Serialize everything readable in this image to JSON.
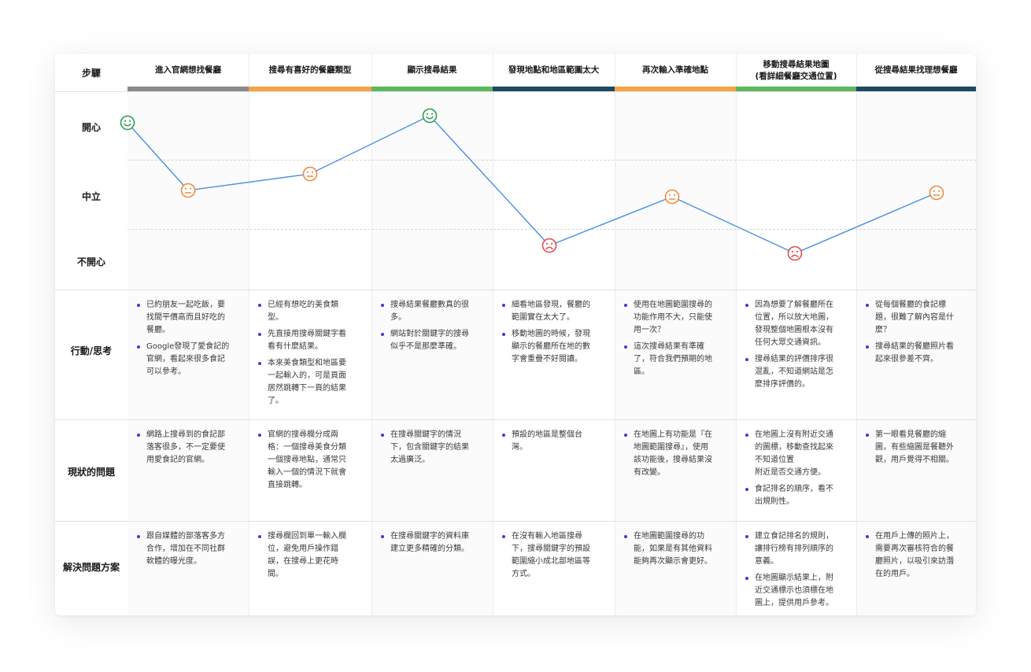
{
  "row_labels": {
    "step": "步驟",
    "happy": "開心",
    "neutral": "中立",
    "unhappy": "不開心",
    "action": "行動/思考",
    "problem": "現狀的問題",
    "solution": "解決問題方案"
  },
  "steps": [
    {
      "title": "進入官網想找餐廳",
      "color": "#8a8a8a",
      "emotion": "happy",
      "actions": [
        "已約朋友一起吃飯，要\n找間平價高而且好吃的\n餐廳。",
        "Google發現了愛食記的\n官網，看起來很多食記\n可以參考。"
      ],
      "problems": [
        "網路上搜尋到的食記部\n落客很多，不一定要使\n用愛食記的官網。"
      ],
      "solutions": [
        "跟自媒體的部落客多方\n合作，增加在不同社群\n軟體的曝光度。"
      ]
    },
    {
      "title": "搜尋有喜好的餐廳類型",
      "color": "#f5a445",
      "emotion": "neutral",
      "actions": [
        "已經有想吃的美食類\n型。",
        "先直接用搜尋關鍵字看\n看有什麼結果。",
        "本來美食類型和地區要\n一起輸入的，可是頁面\n居然跳轉下一頁的結果\n了。"
      ],
      "problems": [
        "官網的搜尋欄分成兩\n格：一個搜尋美食分類\n一個搜尋地點，通常只\n輸入一個的情況下就會\n直接跳轉。"
      ],
      "solutions": [
        "搜尋欄回到單一輸入欄\n位，避免用戶操作錯\n誤，在搜尋上更花時\n間。"
      ]
    },
    {
      "title": "顯示搜尋結果",
      "color": "#5cb85c",
      "emotion": "happy",
      "actions": [
        "搜尋結果餐廳數真的很\n多。",
        "網站對於關鍵字的搜尋\n似乎不是那麼準確。"
      ],
      "problems": [
        "在搜尋關鍵字的情況\n下，包含關鍵字的結果\n太過廣泛。"
      ],
      "solutions": [
        "在搜尋關鍵字的資料庫\n建立更多精確的分類。"
      ]
    },
    {
      "title": "發現地點和地區範圍太大",
      "color": "#1e4a5f",
      "emotion": "unhappy",
      "actions": [
        "細看地區發現，餐廳的\n範圍實在太大了。",
        "移動地圖的時候，發現\n顯示的餐廳所在地的數\n字會重疊不好閱讀。"
      ],
      "problems": [
        "預設的地區是整個台\n灣。"
      ],
      "solutions": [
        "在沒有輸入地區搜尋\n下，搜尋關鍵字的預設\n範圍縮小成北部地區等\n方式。"
      ]
    },
    {
      "title": "再次輸入準確地點",
      "color": "#f5a445",
      "emotion": "neutral",
      "actions": [
        "使用在地圖範圍搜尋的\n功能作用不大，只能使\n用一次？",
        "這次搜尋結果有準確\n了，符合我們預期的地\n區。"
      ],
      "problems": [
        "在地圖上有功能是『在\n地圖範圍搜尋』，使用\n該功能後，搜尋結果沒\n有改變。"
      ],
      "solutions": [
        "在地圖範圍搜尋的功\n能，如果是有其他資料\n能夠再次顯示會更好。"
      ]
    },
    {
      "title": "移動搜尋結果地圖\n(看詳細餐廳交通位置)",
      "color": "#5cb85c",
      "emotion": "unhappy",
      "actions": [
        "因為想要了解餐廳所在\n位置，所以放大地圖，\n發現整個地圖根本沒有\n任何大眾交通資訊。",
        "搜尋結果的評價排序很\n混亂，不知道網站是怎\n麼排序評價的。"
      ],
      "problems": [
        "在地圖上沒有附近交通\n的圖標，移動查找起來\n不知道位置\n附近是否交通方便。",
        "食記排名的順序，看不\n出規則性。"
      ],
      "solutions": [
        "建立食記排名的規則，\n讓排行榜有排列順序的\n意義。",
        "在地圖顯示結果上，附\n近交通標示也須標在地\n圖上，提供用戶參考。"
      ]
    },
    {
      "title": "從搜尋結果找理想餐廳",
      "color": "#1e4a5f",
      "emotion": "neutral",
      "actions": [
        "從每個餐廳的食記標\n題，很難了解內容是什\n麼？",
        "搜尋結果的餐廳照片看\n起來很參差不齊。"
      ],
      "problems": [
        "第一眼看見餐廳的縮\n圖，有些縮圖是餐聽外\n觀，用戶覺得不相關。"
      ],
      "solutions": [
        "在用戶上傳的照片上，\n需要再次審核符合的餐\n廳照片，以吸引來訪潛\n在的用戶。"
      ]
    }
  ],
  "emotion_colors": {
    "happy": "#2e9e4f",
    "neutral": "#f08a3c",
    "unhappy": "#e34d4d"
  },
  "line_color": "#4a90e2"
}
